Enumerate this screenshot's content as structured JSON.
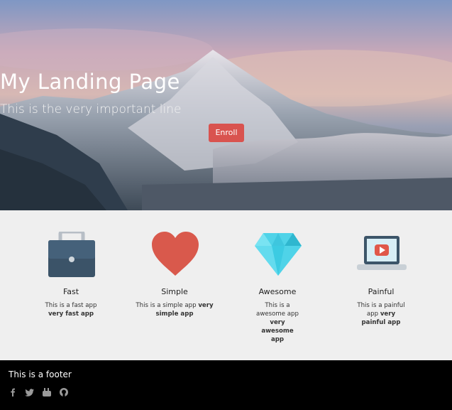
{
  "hero": {
    "title": "My Landing Page",
    "subtitle": "This is the very important line",
    "button_label": "Enroll"
  },
  "features": [
    {
      "name": "Fast",
      "desc_plain": "This is a fast app",
      "desc_bold": "very fast app",
      "icon": "briefcase-icon"
    },
    {
      "name": "Simple",
      "desc_plain": "This is a simple app",
      "desc_bold": "very simple app",
      "icon": "heart-icon"
    },
    {
      "name": "Awesome",
      "desc_plain": "This is a awesome app",
      "desc_bold": "very awesome app",
      "icon": "diamond-icon"
    },
    {
      "name": "Painful",
      "desc_plain": "This is a painful app",
      "desc_bold": "very painful app",
      "icon": "laptop-video-icon"
    }
  ],
  "footer": {
    "text": "This is a footer",
    "social": [
      "facebook-icon",
      "twitter-icon",
      "youtube-icon",
      "github-icon"
    ]
  },
  "colors": {
    "accent": "#d9534f",
    "features_bg": "#efefef",
    "footer_bg": "#000000"
  }
}
